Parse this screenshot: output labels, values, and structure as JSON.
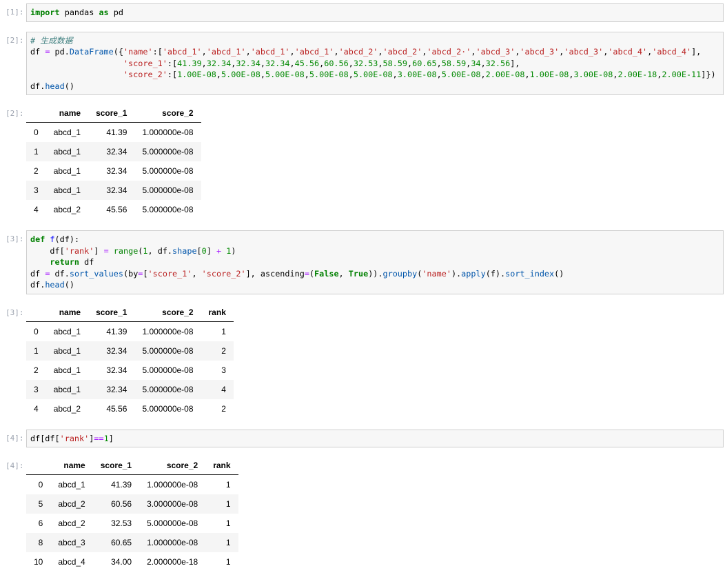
{
  "colors": {
    "page_bg": "#ffffff",
    "cell_bg": "#f7f7f7",
    "cell_border": "#cfcfcf",
    "prompt": "#9ca3af",
    "stripe": "#f5f5f5",
    "header_line": "#1a1a1a",
    "code_text": "#000000",
    "keyword": "#008000",
    "string": "#ba2121",
    "number": "#008800",
    "comment": "#408080",
    "property": "#0055aa",
    "operator": "#aa22ff",
    "definition": "#0000ff",
    "builtin": "#008000"
  },
  "notebook": {
    "cells": [
      {
        "kind": "code",
        "prompt": "[1]:",
        "lines": [
          [
            {
              "t": "import",
              "c": "kw"
            },
            {
              "t": " pandas ",
              "c": ""
            },
            {
              "t": "as",
              "c": "kw"
            },
            {
              "t": " pd",
              "c": ""
            }
          ]
        ]
      },
      {
        "kind": "code",
        "prompt": "[2]:",
        "lines": [
          [
            {
              "t": "# 生成数据",
              "c": "com"
            }
          ],
          [
            {
              "t": "df ",
              "c": ""
            },
            {
              "t": "=",
              "c": "op"
            },
            {
              "t": " pd.",
              "c": ""
            },
            {
              "t": "DataFrame",
              "c": "prop"
            },
            {
              "t": "({",
              "c": ""
            },
            {
              "t": "'name'",
              "c": "str"
            },
            {
              "t": ":[",
              "c": ""
            },
            {
              "t": "'abcd_1'",
              "c": "str"
            },
            {
              "t": ",",
              "c": ""
            },
            {
              "t": "'abcd_1'",
              "c": "str"
            },
            {
              "t": ",",
              "c": ""
            },
            {
              "t": "'abcd_1'",
              "c": "str"
            },
            {
              "t": ",",
              "c": ""
            },
            {
              "t": "'abcd_1'",
              "c": "str"
            },
            {
              "t": ",",
              "c": ""
            },
            {
              "t": "'abcd_2'",
              "c": "str"
            },
            {
              "t": ",",
              "c": ""
            },
            {
              "t": "'abcd_2'",
              "c": "str"
            },
            {
              "t": ",",
              "c": ""
            },
            {
              "t": "'abcd_2·'",
              "c": "str"
            },
            {
              "t": ",",
              "c": ""
            },
            {
              "t": "'abcd_3'",
              "c": "str"
            },
            {
              "t": ",",
              "c": ""
            },
            {
              "t": "'abcd_3'",
              "c": "str"
            },
            {
              "t": ",",
              "c": ""
            },
            {
              "t": "'abcd_3'",
              "c": "str"
            },
            {
              "t": ",",
              "c": ""
            },
            {
              "t": "'abcd_4'",
              "c": "str"
            },
            {
              "t": ",",
              "c": ""
            },
            {
              "t": "'abcd_4'",
              "c": "str"
            },
            {
              "t": "],",
              "c": ""
            }
          ],
          [
            {
              "t": "                   ",
              "c": ""
            },
            {
              "t": "'score_1'",
              "c": "str"
            },
            {
              "t": ":[",
              "c": ""
            },
            {
              "t": "41.39",
              "c": "num"
            },
            {
              "t": ",",
              "c": ""
            },
            {
              "t": "32.34",
              "c": "num"
            },
            {
              "t": ",",
              "c": ""
            },
            {
              "t": "32.34",
              "c": "num"
            },
            {
              "t": ",",
              "c": ""
            },
            {
              "t": "32.34",
              "c": "num"
            },
            {
              "t": ",",
              "c": ""
            },
            {
              "t": "45.56",
              "c": "num"
            },
            {
              "t": ",",
              "c": ""
            },
            {
              "t": "60.56",
              "c": "num"
            },
            {
              "t": ",",
              "c": ""
            },
            {
              "t": "32.53",
              "c": "num"
            },
            {
              "t": ",",
              "c": ""
            },
            {
              "t": "58.59",
              "c": "num"
            },
            {
              "t": ",",
              "c": ""
            },
            {
              "t": "60.65",
              "c": "num"
            },
            {
              "t": ",",
              "c": ""
            },
            {
              "t": "58.59",
              "c": "num"
            },
            {
              "t": ",",
              "c": ""
            },
            {
              "t": "34",
              "c": "num"
            },
            {
              "t": ",",
              "c": ""
            },
            {
              "t": "32.56",
              "c": "num"
            },
            {
              "t": "],",
              "c": ""
            }
          ],
          [
            {
              "t": "                   ",
              "c": ""
            },
            {
              "t": "'score_2'",
              "c": "str"
            },
            {
              "t": ":[",
              "c": ""
            },
            {
              "t": "1.00E-08",
              "c": "num"
            },
            {
              "t": ",",
              "c": ""
            },
            {
              "t": "5.00E-08",
              "c": "num"
            },
            {
              "t": ",",
              "c": ""
            },
            {
              "t": "5.00E-08",
              "c": "num"
            },
            {
              "t": ",",
              "c": ""
            },
            {
              "t": "5.00E-08",
              "c": "num"
            },
            {
              "t": ",",
              "c": ""
            },
            {
              "t": "5.00E-08",
              "c": "num"
            },
            {
              "t": ",",
              "c": ""
            },
            {
              "t": "3.00E-08",
              "c": "num"
            },
            {
              "t": ",",
              "c": ""
            },
            {
              "t": "5.00E-08",
              "c": "num"
            },
            {
              "t": ",",
              "c": ""
            },
            {
              "t": "2.00E-08",
              "c": "num"
            },
            {
              "t": ",",
              "c": ""
            },
            {
              "t": "1.00E-08",
              "c": "num"
            },
            {
              "t": ",",
              "c": ""
            },
            {
              "t": "3.00E-08",
              "c": "num"
            },
            {
              "t": ",",
              "c": ""
            },
            {
              "t": "2.00E-18",
              "c": "num"
            },
            {
              "t": ",",
              "c": ""
            },
            {
              "t": "2.00E-11",
              "c": "num"
            },
            {
              "t": "]})",
              "c": ""
            }
          ],
          [
            {
              "t": "df.",
              "c": ""
            },
            {
              "t": "head",
              "c": "prop"
            },
            {
              "t": "()",
              "c": ""
            }
          ]
        ]
      },
      {
        "kind": "table",
        "prompt": "[2]:",
        "columns": [
          "",
          "name",
          "score_1",
          "score_2"
        ],
        "rows": [
          [
            "0",
            "abcd_1",
            "41.39",
            "1.000000e-08"
          ],
          [
            "1",
            "abcd_1",
            "32.34",
            "5.000000e-08"
          ],
          [
            "2",
            "abcd_1",
            "32.34",
            "5.000000e-08"
          ],
          [
            "3",
            "abcd_1",
            "32.34",
            "5.000000e-08"
          ],
          [
            "4",
            "abcd_2",
            "45.56",
            "5.000000e-08"
          ]
        ]
      },
      {
        "kind": "code",
        "prompt": "[3]:",
        "lines": [
          [
            {
              "t": "def",
              "c": "kw"
            },
            {
              "t": " ",
              "c": ""
            },
            {
              "t": "f",
              "c": "def"
            },
            {
              "t": "(df):",
              "c": ""
            }
          ],
          [
            {
              "t": "    df[",
              "c": ""
            },
            {
              "t": "'rank'",
              "c": "str"
            },
            {
              "t": "] ",
              "c": ""
            },
            {
              "t": "=",
              "c": "op"
            },
            {
              "t": " ",
              "c": ""
            },
            {
              "t": "range",
              "c": "bi"
            },
            {
              "t": "(",
              "c": ""
            },
            {
              "t": "1",
              "c": "num"
            },
            {
              "t": ", df.",
              "c": ""
            },
            {
              "t": "shape",
              "c": "prop"
            },
            {
              "t": "[",
              "c": ""
            },
            {
              "t": "0",
              "c": "num"
            },
            {
              "t": "] ",
              "c": ""
            },
            {
              "t": "+",
              "c": "op"
            },
            {
              "t": " ",
              "c": ""
            },
            {
              "t": "1",
              "c": "num"
            },
            {
              "t": ")",
              "c": ""
            }
          ],
          [
            {
              "t": "    ",
              "c": ""
            },
            {
              "t": "return",
              "c": "kw"
            },
            {
              "t": " df",
              "c": ""
            }
          ],
          [
            {
              "t": "df ",
              "c": ""
            },
            {
              "t": "=",
              "c": "op"
            },
            {
              "t": " df.",
              "c": ""
            },
            {
              "t": "sort_values",
              "c": "prop"
            },
            {
              "t": "(by",
              "c": ""
            },
            {
              "t": "=",
              "c": "op"
            },
            {
              "t": "[",
              "c": ""
            },
            {
              "t": "'score_1'",
              "c": "str"
            },
            {
              "t": ", ",
              "c": ""
            },
            {
              "t": "'score_2'",
              "c": "str"
            },
            {
              "t": "], ascending",
              "c": ""
            },
            {
              "t": "=",
              "c": "op"
            },
            {
              "t": "(",
              "c": ""
            },
            {
              "t": "False",
              "c": "kw"
            },
            {
              "t": ", ",
              "c": ""
            },
            {
              "t": "True",
              "c": "kw"
            },
            {
              "t": ")).",
              "c": ""
            },
            {
              "t": "groupby",
              "c": "prop"
            },
            {
              "t": "(",
              "c": ""
            },
            {
              "t": "'name'",
              "c": "str"
            },
            {
              "t": ").",
              "c": ""
            },
            {
              "t": "apply",
              "c": "prop"
            },
            {
              "t": "(f).",
              "c": ""
            },
            {
              "t": "sort_index",
              "c": "prop"
            },
            {
              "t": "()",
              "c": ""
            }
          ],
          [
            {
              "t": "df.",
              "c": ""
            },
            {
              "t": "head",
              "c": "prop"
            },
            {
              "t": "()",
              "c": ""
            }
          ]
        ]
      },
      {
        "kind": "table",
        "prompt": "[3]:",
        "columns": [
          "",
          "name",
          "score_1",
          "score_2",
          "rank"
        ],
        "rows": [
          [
            "0",
            "abcd_1",
            "41.39",
            "1.000000e-08",
            "1"
          ],
          [
            "1",
            "abcd_1",
            "32.34",
            "5.000000e-08",
            "2"
          ],
          [
            "2",
            "abcd_1",
            "32.34",
            "5.000000e-08",
            "3"
          ],
          [
            "3",
            "abcd_1",
            "32.34",
            "5.000000e-08",
            "4"
          ],
          [
            "4",
            "abcd_2",
            "45.56",
            "5.000000e-08",
            "2"
          ]
        ]
      },
      {
        "kind": "code",
        "prompt": "[4]:",
        "lines": [
          [
            {
              "t": "df[df[",
              "c": ""
            },
            {
              "t": "'rank'",
              "c": "str"
            },
            {
              "t": "]",
              "c": ""
            },
            {
              "t": "==",
              "c": "op"
            },
            {
              "t": "1",
              "c": "num"
            },
            {
              "t": "]",
              "c": ""
            }
          ]
        ]
      },
      {
        "kind": "table",
        "prompt": "[4]:",
        "columns": [
          "",
          "name",
          "score_1",
          "score_2",
          "rank"
        ],
        "rows": [
          [
            "0",
            "abcd_1",
            "41.39",
            "1.000000e-08",
            "1"
          ],
          [
            "5",
            "abcd_2",
            "60.56",
            "3.000000e-08",
            "1"
          ],
          [
            "6",
            "abcd_2",
            "32.53",
            "5.000000e-08",
            "1"
          ],
          [
            "8",
            "abcd_3",
            "60.65",
            "1.000000e-08",
            "1"
          ],
          [
            "10",
            "abcd_4",
            "34.00",
            "2.000000e-18",
            "1"
          ]
        ]
      }
    ]
  }
}
